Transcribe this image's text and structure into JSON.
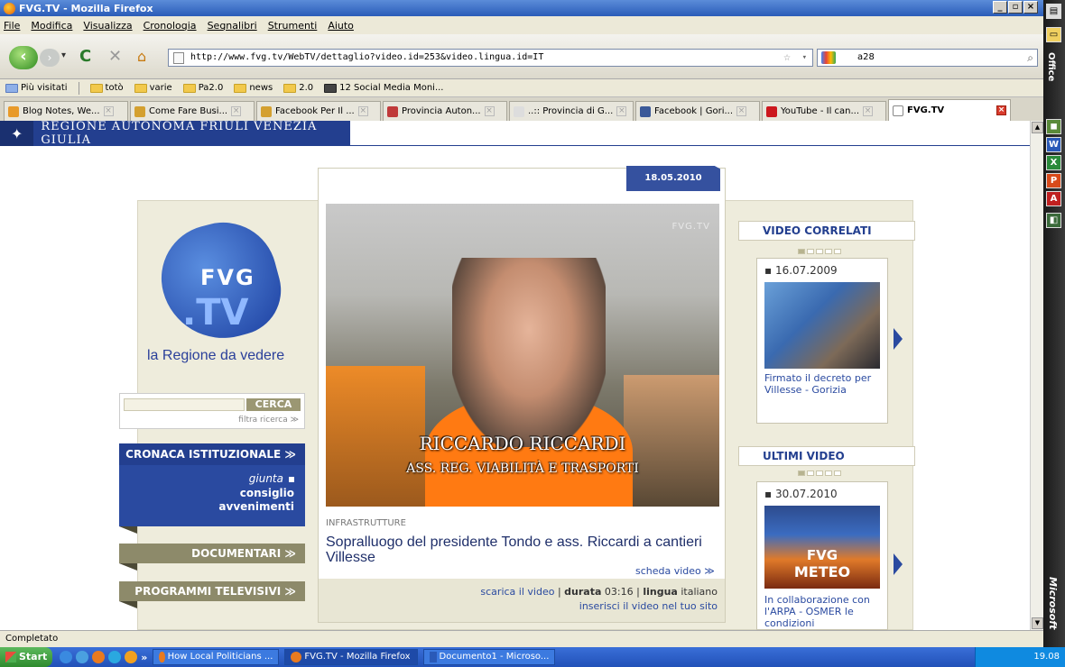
{
  "window": {
    "title": "FVG.TV - Mozilla Firefox",
    "controls": [
      "_",
      "▫",
      "×"
    ]
  },
  "menu": [
    "File",
    "Modifica",
    "Visualizza",
    "Cronologia",
    "Segnalibri",
    "Strumenti",
    "Aiuto"
  ],
  "nav": {
    "url": "http://www.fvg.tv/WebTV/dettaglio?video.id=253&video.lingua.id=IT",
    "search_value": "a28"
  },
  "bookmarks": [
    "Più visitati",
    "totò",
    "varie",
    "Pa2.0",
    "news",
    "2.0",
    "12 Social Media Moni..."
  ],
  "tabs": [
    {
      "label": "Blog Notes, We..."
    },
    {
      "label": "Come Fare Busi..."
    },
    {
      "label": "Facebook Per Il ..."
    },
    {
      "label": "Provincia Auton..."
    },
    {
      "label": "..:: Provincia di G..."
    },
    {
      "label": "Facebook | Gori..."
    },
    {
      "label": "YouTube - Il can..."
    },
    {
      "label": "FVG.TV"
    }
  ],
  "page": {
    "region_title": "REGIONE AUTONOMA FRIULI VENEZIA GIULIA",
    "logo": {
      "line1": "FVG",
      "line2": ".TV"
    },
    "tagline": "la Regione da vedere",
    "search": {
      "button": "CERCA",
      "filter": "filtra ricerca ≫"
    },
    "cronaca": {
      "title": "CRONACA ISTITUZIONALE ≫",
      "items": [
        "giunta",
        "consiglio",
        "avvenimenti"
      ]
    },
    "documentari": "DOCUMENTARI ≫",
    "programmi": "PROGRAMMI TELEVISIVI ≫",
    "video": {
      "date": "18.05.2010",
      "watermark": "FVG.TV",
      "caption_name": "RICCARDO RICCARDI",
      "caption_role": "ASS. REG. VIABILITÀ E TRASPORTI",
      "category": "INFRASTRUTTURE",
      "title": "Sopralluogo del presidente Tondo e ass. Riccardi a cantieri Villesse",
      "scheda": "scheda video ≫",
      "download": "scarica il video",
      "durata_label": "durata",
      "durata": "03:16",
      "lingua_label": "lingua",
      "lingua": "italiano",
      "embed": "inserisci il video nel tuo sito",
      "separator": "|"
    },
    "correlati": {
      "title": "VIDEO CORRELATI",
      "date": "▪ 16.07.2009",
      "text": "Firmato il decreto per Villesse - Gorizia"
    },
    "ultimi": {
      "title": "ULTIMI VIDEO",
      "date": "▪ 30.07.2010",
      "thumb1": "FVG",
      "thumb2": "METEO",
      "text": "In collaborazione con l'ARPA - OSMER le condizioni"
    }
  },
  "office_bar": {
    "label": "Office",
    "brand": "Microsoft"
  },
  "status": "Completato",
  "taskbar": {
    "start": "Start",
    "chevron": "»",
    "buttons": [
      "How Local Politicians ...",
      "FVG.TV - Mozilla Firefox",
      "Documento1 - Microso..."
    ],
    "clock": "19.08"
  }
}
